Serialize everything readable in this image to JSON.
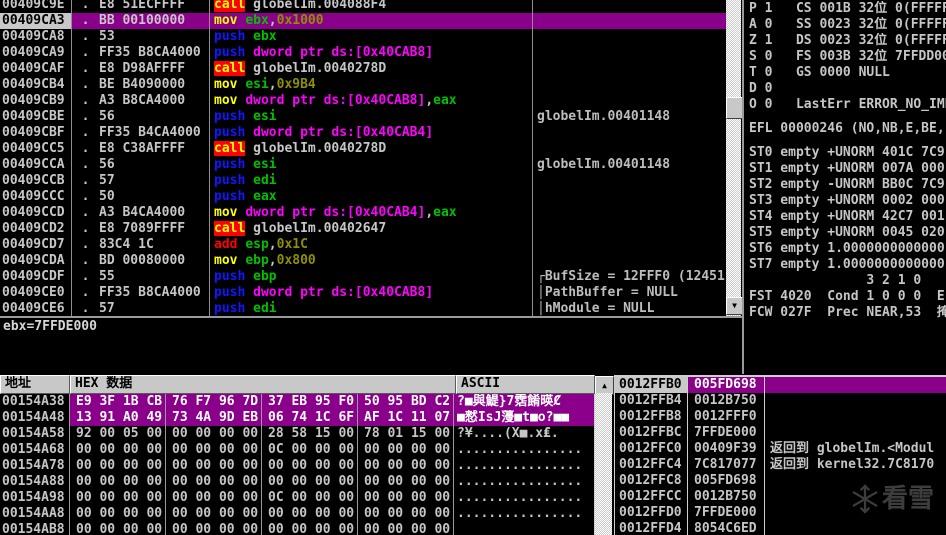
{
  "disasm": {
    "dot_marker": ".",
    "rows": [
      {
        "addr": "00409C9E",
        "bytes": "E8 51ECFFFF",
        "instr": [
          [
            "call",
            "call"
          ],
          [
            " globelIm.004088F4",
            "def"
          ]
        ],
        "comment": "",
        "sel": false
      },
      {
        "addr": "00409CA3",
        "bytes": "BB 00100000",
        "instr": [
          [
            "mov",
            "mov"
          ],
          [
            " ",
            "def"
          ],
          [
            "ebx",
            "reg"
          ],
          [
            ",",
            "def"
          ],
          [
            "0x1000",
            "imm"
          ]
        ],
        "comment": "",
        "sel": true
      },
      {
        "addr": "00409CA8",
        "bytes": "53",
        "instr": [
          [
            "push",
            "push"
          ],
          [
            " ",
            "def"
          ],
          [
            "ebx",
            "reg"
          ]
        ],
        "comment": "",
        "sel": false
      },
      {
        "addr": "00409CA9",
        "bytes": "FF35 B8CA4000",
        "instr": [
          [
            "push",
            "push"
          ],
          [
            " ",
            "def"
          ],
          [
            "dword ptr ds:[0x40CAB8]",
            "mem"
          ]
        ],
        "comment": "",
        "sel": false
      },
      {
        "addr": "00409CAF",
        "bytes": "E8 D98AFFFF",
        "instr": [
          [
            "call",
            "call"
          ],
          [
            " globelIm.0040278D",
            "def"
          ]
        ],
        "comment": "",
        "sel": false
      },
      {
        "addr": "00409CB4",
        "bytes": "BE B4090000",
        "instr": [
          [
            "mov",
            "mov"
          ],
          [
            " ",
            "def"
          ],
          [
            "esi",
            "reg"
          ],
          [
            ",",
            "def"
          ],
          [
            "0x9B4",
            "imm"
          ]
        ],
        "comment": "",
        "sel": false
      },
      {
        "addr": "00409CB9",
        "bytes": "A3 B8CA4000",
        "instr": [
          [
            "mov",
            "mov"
          ],
          [
            " ",
            "def"
          ],
          [
            "dword ptr ds:[0x40CAB8]",
            "mem"
          ],
          [
            ",",
            "def"
          ],
          [
            "eax",
            "reg"
          ]
        ],
        "comment": "",
        "sel": false
      },
      {
        "addr": "00409CBE",
        "bytes": "56",
        "instr": [
          [
            "push",
            "push"
          ],
          [
            " ",
            "def"
          ],
          [
            "esi",
            "reg"
          ]
        ],
        "comment": "globelIm.00401148",
        "sel": false
      },
      {
        "addr": "00409CBF",
        "bytes": "FF35 B4CA4000",
        "instr": [
          [
            "push",
            "push"
          ],
          [
            " ",
            "def"
          ],
          [
            "dword ptr ds:[0x40CAB4]",
            "mem"
          ]
        ],
        "comment": "",
        "sel": false
      },
      {
        "addr": "00409CC5",
        "bytes": "E8 C38AFFFF",
        "instr": [
          [
            "call",
            "call"
          ],
          [
            " globelIm.0040278D",
            "def"
          ]
        ],
        "comment": "",
        "sel": false
      },
      {
        "addr": "00409CCA",
        "bytes": "56",
        "instr": [
          [
            "push",
            "push"
          ],
          [
            " ",
            "def"
          ],
          [
            "esi",
            "reg"
          ]
        ],
        "comment": "globelIm.00401148",
        "sel": false
      },
      {
        "addr": "00409CCB",
        "bytes": "57",
        "instr": [
          [
            "push",
            "push"
          ],
          [
            " ",
            "def"
          ],
          [
            "edi",
            "reg"
          ]
        ],
        "comment": "",
        "sel": false
      },
      {
        "addr": "00409CCC",
        "bytes": "50",
        "instr": [
          [
            "push",
            "push"
          ],
          [
            " ",
            "def"
          ],
          [
            "eax",
            "reg"
          ]
        ],
        "comment": "",
        "sel": false
      },
      {
        "addr": "00409CCD",
        "bytes": "A3 B4CA4000",
        "instr": [
          [
            "mov",
            "mov"
          ],
          [
            " ",
            "def"
          ],
          [
            "dword ptr ds:[0x40CAB4]",
            "mem"
          ],
          [
            ",",
            "def"
          ],
          [
            "eax",
            "reg"
          ]
        ],
        "comment": "",
        "sel": false
      },
      {
        "addr": "00409CD2",
        "bytes": "E8 7089FFFF",
        "instr": [
          [
            "call",
            "call"
          ],
          [
            " globelIm.00402647",
            "def"
          ]
        ],
        "comment": "",
        "sel": false
      },
      {
        "addr": "00409CD7",
        "bytes": "83C4 1C",
        "instr": [
          [
            "add",
            "add"
          ],
          [
            " ",
            "def"
          ],
          [
            "esp",
            "reg"
          ],
          [
            ",",
            "def"
          ],
          [
            "0x1C",
            "imm"
          ]
        ],
        "comment": "",
        "sel": false
      },
      {
        "addr": "00409CDA",
        "bytes": "BD 00080000",
        "instr": [
          [
            "mov",
            "mov"
          ],
          [
            " ",
            "def"
          ],
          [
            "ebp",
            "reg"
          ],
          [
            ",",
            "def"
          ],
          [
            "0x800",
            "imm"
          ]
        ],
        "comment": "",
        "sel": false
      },
      {
        "addr": "00409CDF",
        "bytes": "55",
        "instr": [
          [
            "push",
            "push"
          ],
          [
            " ",
            "def"
          ],
          [
            "ebp",
            "reg"
          ]
        ],
        "comment": "┌BufSize = 12FFF0 (12451",
        "sel": false
      },
      {
        "addr": "00409CE0",
        "bytes": "FF35 B8CA4000",
        "instr": [
          [
            "push",
            "push"
          ],
          [
            " ",
            "def"
          ],
          [
            "dword ptr ds:[0x40CAB8]",
            "mem"
          ]
        ],
        "comment": "│PathBuffer = NULL",
        "sel": false
      },
      {
        "addr": "00409CE6",
        "bytes": "57",
        "instr": [
          [
            "push",
            "push"
          ],
          [
            " ",
            "def"
          ],
          [
            "edi",
            "reg"
          ]
        ],
        "comment": "│hModule = NULL",
        "sel": false
      }
    ]
  },
  "registers": {
    "lines": [
      "P 1   CS 001B 32位 0(FFFFF",
      "A 0   SS 0023 32位 0(FFFFF",
      "Z 1   DS 0023 32位 0(FFFFF",
      "S 0   FS 003B 32位 7FFDD00",
      "T 0   GS 0000 NULL",
      "D 0",
      "O 0   LastErr ERROR_NO_IMP",
      "",
      "EFL 00000246 (NO,NB,E,BE,",
      "",
      "ST0 empty +UNORM 401C 7C9",
      "ST1 empty +UNORM 007A 000",
      "ST2 empty -UNORM BB0C 7C9",
      "ST3 empty +UNORM 0002 000",
      "ST4 empty +UNORM 42C7 001",
      "ST5 empty +UNORM 0045 020",
      "ST6 empty 1.0000000000000",
      "ST7 empty 1.0000000000000",
      "               3 2 1 0",
      "FST 4020  Cond 1 0 0 0  E",
      "FCW 027F  Prec NEAR,53  掩"
    ]
  },
  "info": {
    "text": "ebx=7FFDE000"
  },
  "dump": {
    "headers": {
      "addr": "地址",
      "hex": "HEX 数据",
      "ascii": "ASCII"
    },
    "rows": [
      {
        "addr": "00154A38",
        "groups": [
          "E9 3F 1B CB",
          "76 F7 96 7D",
          "37 EB 95 F0",
          "50 95 BD C2"
        ],
        "ascii": "?■與鯷}7霑餚暎Ȼ",
        "sel": true
      },
      {
        "addr": "00154A48",
        "groups": [
          "13 91 A0 49",
          "73 4A 9D EB",
          "06 74 1C 6F",
          "AF 1C 11 07"
        ],
        "ascii": "■憖IsJ薓■t■o?■■",
        "sel": true
      },
      {
        "addr": "00154A58",
        "groups": [
          "92 00 05 00",
          "00 00 00 00",
          "28 58 15 00",
          "78 01 15 00"
        ],
        "ascii": "?¥....(X■.x₤.",
        "sel": false
      },
      {
        "addr": "00154A68",
        "groups": [
          "00 00 00 00",
          "00 00 00 00",
          "0C 00 00 00",
          "00 00 00 00"
        ],
        "ascii": "................",
        "sel": false
      },
      {
        "addr": "00154A78",
        "groups": [
          "00 00 00 00",
          "00 00 00 00",
          "00 00 00 00",
          "00 00 00 00"
        ],
        "ascii": "................",
        "sel": false
      },
      {
        "addr": "00154A88",
        "groups": [
          "00 00 00 00",
          "00 00 00 00",
          "00 00 00 00",
          "00 00 00 00"
        ],
        "ascii": "................",
        "sel": false
      },
      {
        "addr": "00154A98",
        "groups": [
          "00 00 00 00",
          "00 00 00 00",
          "0C 00 00 00",
          "00 00 00 00"
        ],
        "ascii": "................",
        "sel": false
      },
      {
        "addr": "00154AA8",
        "groups": [
          "00 00 00 00",
          "00 00 00 00",
          "00 00 00 00",
          "00 00 00 00"
        ],
        "ascii": "................",
        "sel": false
      },
      {
        "addr": "00154AB8",
        "groups": [
          "00 00 00 00",
          "00 00 00 00",
          "00 00 00 00",
          "00 00 00 00"
        ],
        "ascii": "",
        "sel": false
      }
    ]
  },
  "stack": {
    "rows": [
      {
        "addr": "0012FFB0",
        "val": "005FD698",
        "comment": "",
        "sel": true
      },
      {
        "addr": "0012FFB4",
        "val": "0012B750",
        "comment": "",
        "sel": false
      },
      {
        "addr": "0012FFB8",
        "val": "0012FFF0",
        "comment": "",
        "sel": false
      },
      {
        "addr": "0012FFBC",
        "val": "7FFDE000",
        "comment": "",
        "sel": false
      },
      {
        "addr": "0012FFC0",
        "val": "00409F39",
        "comment": "返回到 globelIm.<Modul",
        "sel": false
      },
      {
        "addr": "0012FFC4",
        "val": "7C817077",
        "comment": "返回到 kernel32.7C8170",
        "sel": false
      },
      {
        "addr": "0012FFC8",
        "val": "005FD698",
        "comment": "",
        "sel": false
      },
      {
        "addr": "0012FFCC",
        "val": "0012B750",
        "comment": "",
        "sel": false
      },
      {
        "addr": "0012FFD0",
        "val": "7FFDE000",
        "comment": "",
        "sel": false
      },
      {
        "addr": "0012FFD4",
        "val": "8054C6ED",
        "comment": "",
        "sel": false
      }
    ]
  },
  "watermark": {
    "text": "看雪",
    "icon": "snowflake"
  },
  "scrollbars": {
    "disasm_down_glyph": "▼",
    "dump_up_glyph": "▲"
  },
  "colors": {
    "selection_purple": "#8B008B",
    "call_highlight_bg": "#FF0000",
    "call_highlight_text": "#FFFF00",
    "mnemonic_push": "#1515FF",
    "mnemonic_mov": "#FFFF00",
    "mnemonic_add": "#FF0000",
    "register_operand": "#00C000",
    "memory_operand": "#FF00FF",
    "immediate_operand": "#8F8F00",
    "default_text": "#C6C6C6",
    "chrome_gray": "#C8C8C8"
  }
}
